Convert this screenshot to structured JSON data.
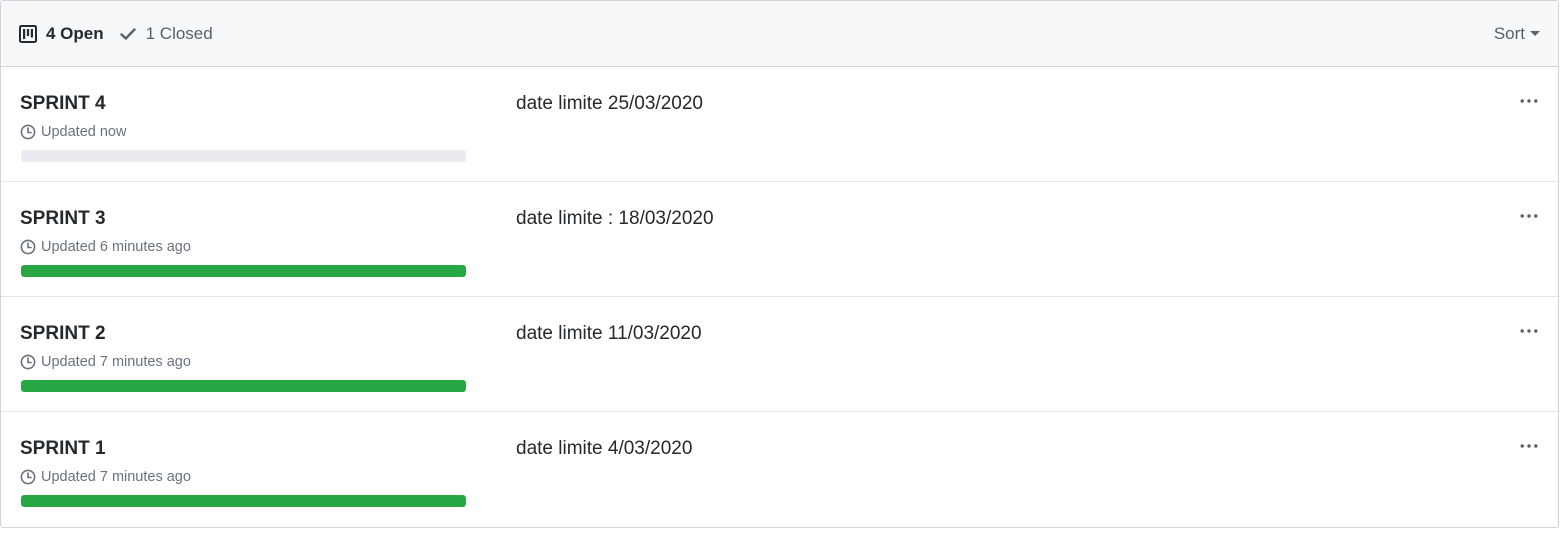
{
  "header": {
    "open_label": "4 Open",
    "closed_label": "1 Closed",
    "sort_label": "Sort"
  },
  "projects": [
    {
      "title": "SPRINT 4",
      "updated": "Updated now",
      "description": "date limite 25/03/2020",
      "progress_percent": 0
    },
    {
      "title": "SPRINT 3",
      "updated": "Updated 6 minutes ago",
      "description": "date limite : 18/03/2020",
      "progress_percent": 100
    },
    {
      "title": "SPRINT 2",
      "updated": "Updated 7 minutes ago",
      "description": "date limite 11/03/2020",
      "progress_percent": 100
    },
    {
      "title": "SPRINT 1",
      "updated": "Updated 7 minutes ago",
      "description": "date limite 4/03/2020",
      "progress_percent": 100
    }
  ],
  "icons": {
    "open": "project-board-icon",
    "closed": "check-icon",
    "updated": "clock-icon",
    "more": "kebab-horizontal-icon"
  },
  "colors": {
    "progress_done": "#28a745",
    "progress_track": "#e9ebee",
    "header_bg": "#f6f8fa"
  }
}
